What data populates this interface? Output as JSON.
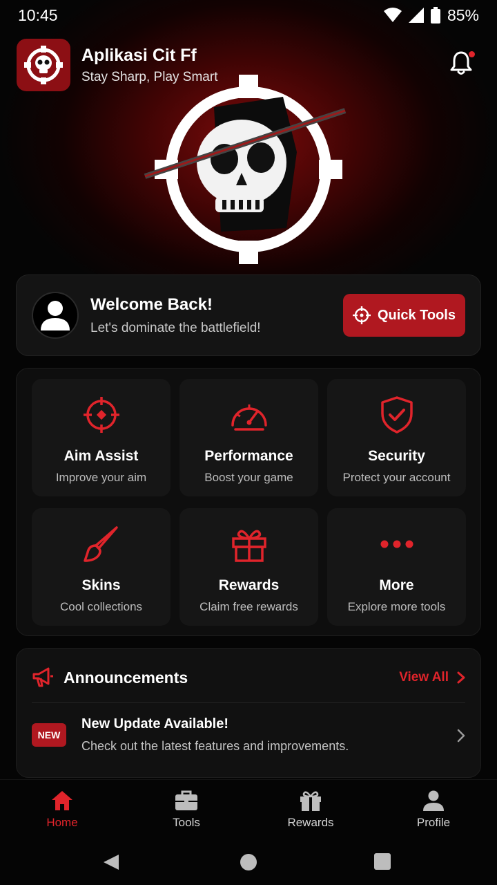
{
  "status_bar": {
    "time": "10:45",
    "battery": "85%"
  },
  "app": {
    "title": "Aplikasi Cit Ff",
    "subtitle": "Stay Sharp, Play Smart",
    "logo_icon": "skull-crosshair-icon",
    "notification_icon": "bell-icon",
    "has_notification": true
  },
  "welcome": {
    "title": "Welcome Back!",
    "subtitle": "Let's dominate the battlefield!",
    "avatar_icon": "user-icon",
    "button_label": "Quick Tools",
    "button_icon": "crosshair-icon"
  },
  "tools": [
    {
      "title": "Aim Assist",
      "subtitle": "Improve your aim",
      "icon": "crosshair-icon"
    },
    {
      "title": "Performance",
      "subtitle": "Boost your game",
      "icon": "speedometer-icon"
    },
    {
      "title": "Security",
      "subtitle": "Protect your account",
      "icon": "shield-check-icon"
    },
    {
      "title": "Skins",
      "subtitle": "Cool collections",
      "icon": "brush-icon"
    },
    {
      "title": "Rewards",
      "subtitle": "Claim free rewards",
      "icon": "gift-icon"
    },
    {
      "title": "More",
      "subtitle": "Explore more tools",
      "icon": "more-dots-icon"
    }
  ],
  "announcements": {
    "title": "Announcements",
    "view_all": "View All",
    "icon": "megaphone-icon",
    "items": [
      {
        "badge": "NEW",
        "title": "New Update Available!",
        "body": "Check out the latest features and improvements."
      }
    ]
  },
  "bottom_nav": [
    {
      "label": "Home",
      "icon": "home-icon",
      "active": true
    },
    {
      "label": "Tools",
      "icon": "toolbox-icon",
      "active": false
    },
    {
      "label": "Rewards",
      "icon": "gift-icon",
      "active": false
    },
    {
      "label": "Profile",
      "icon": "user-icon",
      "active": false
    }
  ],
  "colors": {
    "accent": "#e0242b",
    "accent_dark": "#b01820",
    "background": "#050505",
    "card": "#141414"
  }
}
